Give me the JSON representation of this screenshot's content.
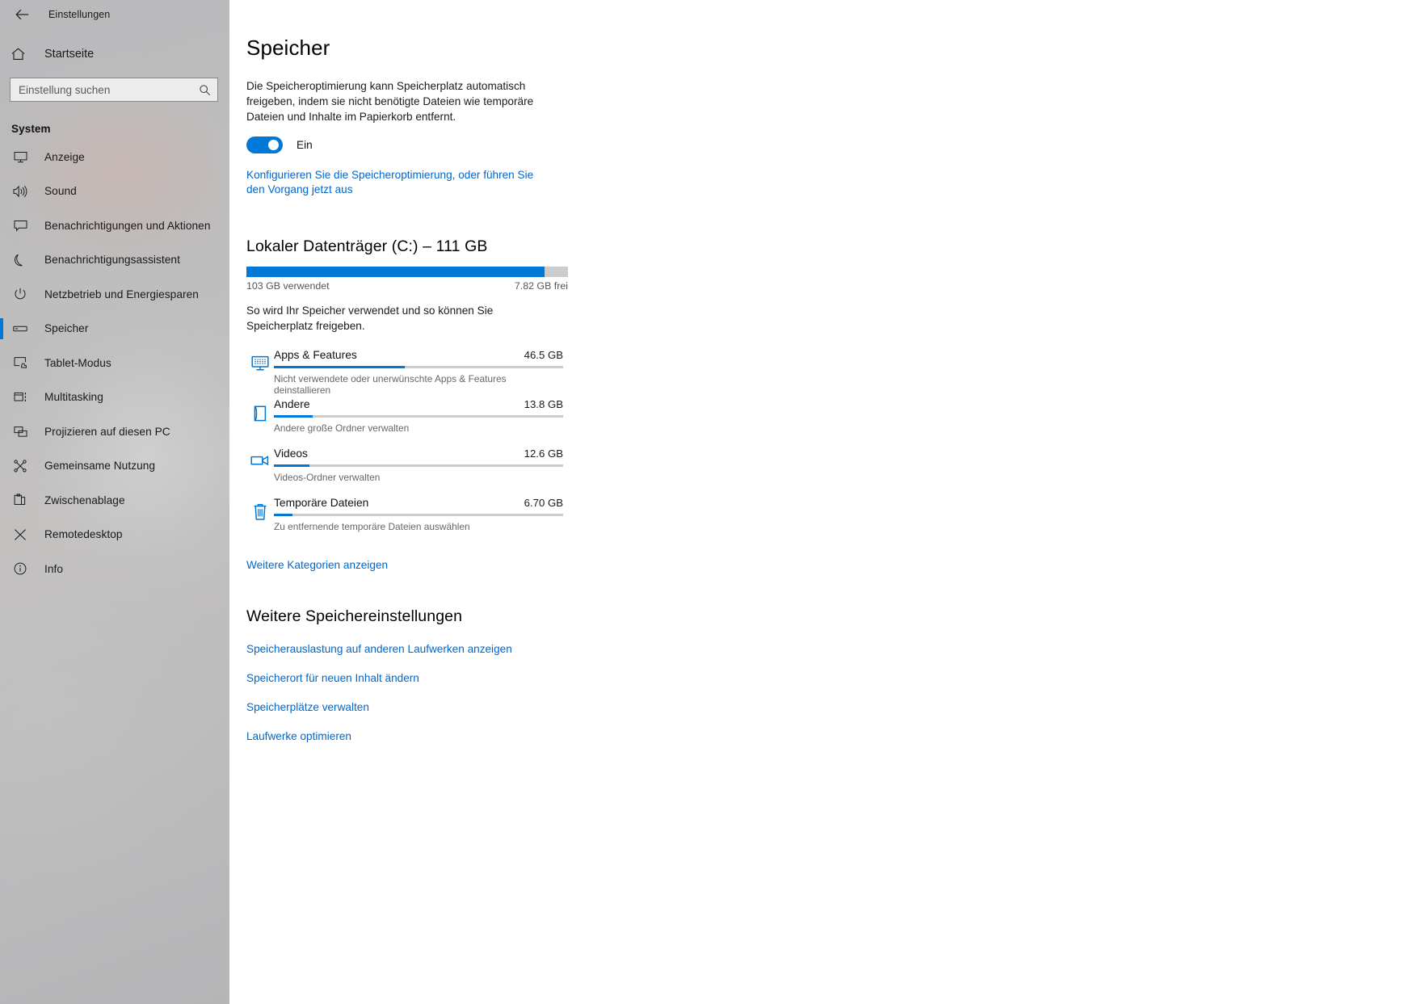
{
  "window": {
    "back_icon": "back-arrow-icon",
    "app_title": "Einstellungen"
  },
  "sidebar": {
    "home": {
      "label": "Startseite",
      "icon": "home-icon"
    },
    "search": {
      "placeholder": "Einstellung suchen",
      "value": "",
      "icon": "search-icon"
    },
    "group_header": "System",
    "items": [
      {
        "label": "Anzeige",
        "icon": "monitor-icon",
        "selected": false
      },
      {
        "label": "Sound",
        "icon": "speaker-icon",
        "selected": false
      },
      {
        "label": "Benachrichtigungen und Aktionen",
        "icon": "notification-icon",
        "selected": false
      },
      {
        "label": "Benachrichtigungsassistent",
        "icon": "moon-icon",
        "selected": false
      },
      {
        "label": "Netzbetrieb und Energiesparen",
        "icon": "power-icon",
        "selected": false
      },
      {
        "label": "Speicher",
        "icon": "drive-icon",
        "selected": true
      },
      {
        "label": "Tablet-Modus",
        "icon": "tablet-icon",
        "selected": false
      },
      {
        "label": "Multitasking",
        "icon": "multitasking-icon",
        "selected": false
      },
      {
        "label": "Projizieren auf diesen PC",
        "icon": "project-screen-icon",
        "selected": false
      },
      {
        "label": "Gemeinsame Nutzung",
        "icon": "share-icon",
        "selected": false
      },
      {
        "label": "Zwischenablage",
        "icon": "clipboard-icon",
        "selected": false
      },
      {
        "label": "Remotedesktop",
        "icon": "remote-desktop-icon",
        "selected": false
      },
      {
        "label": "Info",
        "icon": "info-icon",
        "selected": false
      }
    ]
  },
  "main": {
    "page_title": "Speicher",
    "intro_text": "Die Speicheroptimierung kann Speicherplatz automatisch freigeben, indem sie nicht benötigte Dateien wie temporäre Dateien und Inhalte im Papierkorb entfernt.",
    "storage_sense_toggle": {
      "state_label": "Ein",
      "on": true
    },
    "configure_link": "Konfigurieren Sie die Speicheroptimierung, oder führen Sie den Vorgang jetzt aus",
    "drive": {
      "title": "Lokaler Datenträger (C:) – 111 GB",
      "used_label": "103 GB verwendet",
      "free_label": "7.82 GB frei",
      "used_percent": 92.8
    },
    "usage_description": "So wird Ihr Speicher verwendet und so können Sie Speicherplatz freigeben.",
    "categories": [
      {
        "name": "Apps & Features",
        "size": "46.5 GB",
        "subtitle": "Nicht verwendete oder unerwünschte Apps & Features deinstallieren",
        "icon": "apps-monitor-icon",
        "bar_percent": 45.2
      },
      {
        "name": "Andere",
        "size": "13.8 GB",
        "subtitle": "Andere große Ordner verwalten",
        "icon": "folder-icon",
        "bar_percent": 13.4
      },
      {
        "name": "Videos",
        "size": "12.6 GB",
        "subtitle": "Videos-Ordner verwalten",
        "icon": "video-camera-icon",
        "bar_percent": 12.2
      },
      {
        "name": "Temporäre Dateien",
        "size": "6.70 GB",
        "subtitle": "Zu entfernende temporäre Dateien auswählen",
        "icon": "trash-icon",
        "bar_percent": 6.5
      }
    ],
    "show_more_categories": "Weitere Kategorien anzeigen",
    "more_settings_title": "Weitere Speichereinstellungen",
    "more_settings_links": [
      "Speicherauslastung auf anderen Laufwerken anzeigen",
      "Speicherort für neuen Inhalt ändern",
      "Speicherplätze verwalten",
      "Laufwerke optimieren"
    ]
  },
  "colors": {
    "accent": "#0078d7",
    "link": "#0066cc",
    "track": "#cccccc"
  }
}
